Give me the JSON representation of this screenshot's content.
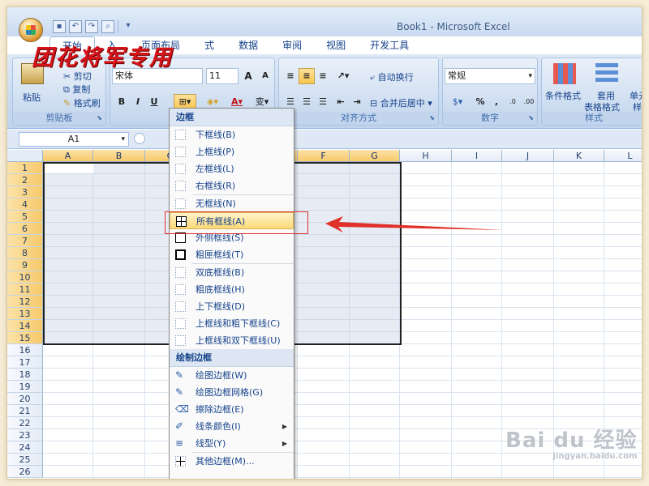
{
  "window": {
    "title": "Book1 - Microsoft Excel"
  },
  "quick_access": [
    "save-icon",
    "undo-icon",
    "redo-icon",
    "print-preview-icon"
  ],
  "overlay_logo": "团花将军专用",
  "tabs": [
    {
      "label": "开始",
      "active": true
    },
    {
      "label": "入"
    },
    {
      "label": "页面布局"
    },
    {
      "label": "式"
    },
    {
      "label": "数据"
    },
    {
      "label": "审阅"
    },
    {
      "label": "视图"
    },
    {
      "label": "开发工具"
    }
  ],
  "ribbon": {
    "clipboard": {
      "label": "剪贴板",
      "paste": "粘贴",
      "cut": "剪切",
      "copy": "复制",
      "format_painter": "格式刷"
    },
    "font": {
      "name": "宋体",
      "size": "11",
      "bold": "B",
      "italic": "I",
      "underline": "U"
    },
    "alignment": {
      "label": "对齐方式",
      "wrap_text": "自动换行",
      "merge_center": "合并后居中"
    },
    "number": {
      "label": "数字",
      "format": "常规",
      "percent": "%",
      "comma": ","
    },
    "styles": {
      "label": "样式",
      "conditional": "条件格式",
      "table": "套用",
      "table2": "表格格式",
      "cell": "单元",
      "cell2": "样"
    }
  },
  "formula_bar": {
    "name_box": "A1"
  },
  "grid": {
    "columns": [
      "A",
      "B",
      "C",
      "D",
      "E",
      "F",
      "G",
      "H",
      "I",
      "J",
      "K",
      "L"
    ],
    "rows": [
      "1",
      "2",
      "3",
      "4",
      "5",
      "6",
      "7",
      "8",
      "9",
      "10",
      "11",
      "12",
      "13",
      "14",
      "15",
      "16",
      "17",
      "18",
      "19",
      "20",
      "21",
      "22",
      "23",
      "24",
      "25",
      "26"
    ]
  },
  "menu": {
    "section1": "边框",
    "items1": [
      {
        "label": "下框线(B)",
        "icon": "bottom-border-icon"
      },
      {
        "label": "上框线(P)",
        "icon": "top-border-icon"
      },
      {
        "label": "左框线(L)",
        "icon": "left-border-icon"
      },
      {
        "label": "右框线(R)",
        "icon": "right-border-icon"
      },
      {
        "label": "无框线(N)",
        "icon": "no-border-icon"
      },
      {
        "label": "所有框线(A)",
        "icon": "all-borders-icon",
        "highlighted": true
      },
      {
        "label": "外侧框线(S)",
        "icon": "outside-borders-icon"
      },
      {
        "label": "粗匣框线(T)",
        "icon": "thick-box-border-icon"
      },
      {
        "label": "双底框线(B)",
        "icon": "double-bottom-border-icon"
      },
      {
        "label": "粗底框线(H)",
        "icon": "thick-bottom-border-icon"
      },
      {
        "label": "上下框线(D)",
        "icon": "top-bottom-border-icon"
      },
      {
        "label": "上框线和粗下框线(C)",
        "icon": "top-thick-bottom-border-icon"
      },
      {
        "label": "上框线和双下框线(U)",
        "icon": "top-double-bottom-border-icon"
      }
    ],
    "section2": "绘制边框",
    "items2": [
      {
        "label": "绘图边框(W)",
        "icon": "draw-border-icon"
      },
      {
        "label": "绘图边框网格(G)",
        "icon": "draw-border-grid-icon"
      },
      {
        "label": "擦除边框(E)",
        "icon": "erase-border-icon"
      },
      {
        "label": "线条颜色(I)",
        "icon": "line-color-icon",
        "submenu": true
      },
      {
        "label": "线型(Y)",
        "icon": "line-style-icon",
        "submenu": true
      },
      {
        "label": "其他边框(M)...",
        "icon": "more-borders-icon"
      }
    ]
  },
  "watermark": {
    "main": "Bai du 经验",
    "sub": "jingyan.baidu.com"
  },
  "colors": {
    "annotation": "#e0302a",
    "accent": "#15428b"
  }
}
